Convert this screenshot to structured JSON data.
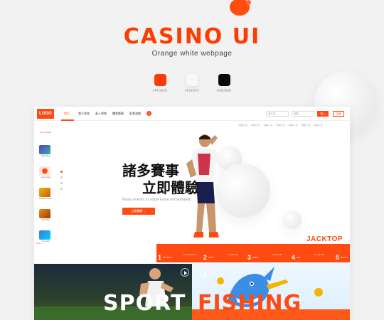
{
  "brand": {
    "title": "CASINO UI",
    "subtitle": "Orange white webpage"
  },
  "palette": [
    {
      "hex": "#FF3A00",
      "label": "#FF3A00"
    },
    {
      "hex": "#F2F2F2",
      "label": "#F2F2F2"
    },
    {
      "hex": "#080B0D",
      "label": "#080B0D"
    }
  ],
  "nav": {
    "logo": "LOGO",
    "items": [
      "首页",
      "電子游戏",
      "真人视频",
      "體育賽事",
      "彩票游戲"
    ],
    "badge": "4",
    "account_placeholder": "用户名",
    "password_placeholder": "密码",
    "login": "登入",
    "register": "注册"
  },
  "ticker": "一等獎公告 · 一等獎公告 · 一等獎公告 · 一等獎公告 · 一等獎公告 · 一等獎公告 · 一等獎公告",
  "sidebar": {
    "hot": "HOT GAME",
    "games": [
      "Leprechaun",
      "Lucky Forge",
      "Fantastic Forest",
      "Jazz Slots",
      "Lion Gold",
      "Buffalo"
    ],
    "more": "more ›"
  },
  "hero": {
    "title_line1": "諸多賽事",
    "title_line2": "立即體驗",
    "sub": "Many events to experience immediately",
    "button": "立即體驗 →"
  },
  "jackpot": {
    "label": "JACKTOP",
    "items": [
      {
        "num": "1",
        "name": "Hot Shots",
        "amount": "¥ 335,362.00"
      },
      {
        "num": "2",
        "name": "Tomb",
        "amount": "¥ 6,453.00"
      },
      {
        "num": "3",
        "name": "Shark",
        "amount": "¥ 6,263.00"
      },
      {
        "num": "4",
        "name": "Lion",
        "amount": "¥ 6,315.00"
      },
      {
        "num": "5",
        "name": "Buccan",
        "amount": ""
      }
    ]
  },
  "banners": {
    "sport": "SPORT",
    "fishing": "FISHING"
  }
}
